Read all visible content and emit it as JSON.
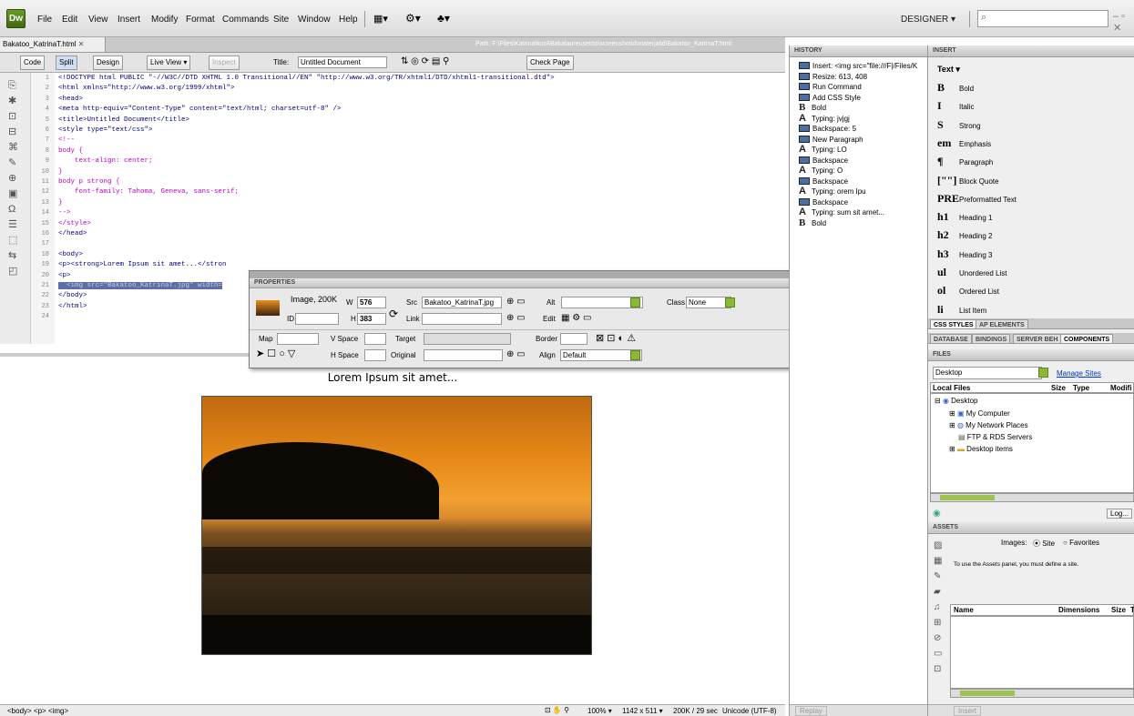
{
  "app": {
    "logo": "Dw",
    "workspace": "DESIGNER"
  },
  "menu": [
    "File",
    "Edit",
    "View",
    "Insert",
    "Modify",
    "Format",
    "Commands",
    "Site",
    "Window",
    "Help"
  ],
  "doc": {
    "tab": "Bakatoo_KatrinaT.html",
    "path": "Path: F:\\Files\\Katrina\\kool\\Bakalaureusetöö\\screenshotid\\materjalid\\Bakatoo_KatrinaT.html"
  },
  "toolbar": {
    "code": "Code",
    "split": "Split",
    "design": "Design",
    "live_view": "Live View",
    "inspect": "Inspect",
    "title_label": "Title:",
    "title_value": "Untitled Document",
    "check_page": "Check Page"
  },
  "code": {
    "line_numbers": [
      "1",
      "2",
      "3",
      "4",
      "5",
      "6",
      "7",
      "8",
      "9",
      "10",
      "11",
      "12",
      "13",
      "14",
      "15",
      "16",
      "17",
      "18",
      "19",
      "20",
      "21",
      "22",
      "23",
      "24"
    ],
    "lines": [
      "<!DOCTYPE html PUBLIC \"-//W3C//DTD XHTML 1.0 Transitional//EN\" \"http://www.w3.org/TR/xhtml1/DTD/xhtml1-transitional.dtd\">",
      "<html xmlns=\"http://www.w3.org/1999/xhtml\">",
      "<head>",
      "<meta http-equiv=\"Content-Type\" content=\"text/html; charset=utf-8\" />",
      "<title>Untitled Document</title>",
      "<style type=\"text/css\">",
      "<!--",
      "body {",
      "    text-align: center;",
      "}",
      "body p strong {",
      "    font-family: Tahoma, Geneva, sans-serif;",
      "}",
      "-->",
      "</style>",
      "</head>",
      "",
      "<body>",
      "<p><strong>Lorem Ipsum sit amet...</stron",
      "<p>",
      "  <img src=\"Bakatoo_KatrinaT.jpg\" width=",
      "</body>",
      "</html>",
      ""
    ]
  },
  "design": {
    "heading": "Lorem Ipsum sit amet..."
  },
  "statusbar": {
    "tags": "<body> <p> <img>",
    "zoom": "100%",
    "size": "1142 x 511",
    "download": "200K / 29 sec",
    "encoding": "Unicode (UTF-8)"
  },
  "properties": {
    "title": "PROPERTIES",
    "type": "Image, 200K",
    "w_label": "W",
    "w_value": "576",
    "h_label": "H",
    "h_value": "383",
    "id_label": "ID",
    "src_label": "Src",
    "src_value": "Bakatoo_KatrinaT.jpg",
    "link_label": "Link",
    "alt_label": "Alt",
    "edit_label": "Edit",
    "class_label": "Class",
    "class_value": "None",
    "map_label": "Map",
    "vspace_label": "V Space",
    "hspace_label": "H Space",
    "target_label": "Target",
    "original_label": "Original",
    "border_label": "Border",
    "align_label": "Align",
    "align_value": "Default"
  },
  "history": {
    "title": "HISTORY",
    "items": [
      {
        "icon": "box",
        "text": "Insert: <img src=\"file:///F|/Files/K"
      },
      {
        "icon": "box",
        "text": "Resize: 613, 408"
      },
      {
        "icon": "box",
        "text": "Run Command"
      },
      {
        "icon": "box",
        "text": "Add CSS Style"
      },
      {
        "icon": "B",
        "text": "Bold"
      },
      {
        "icon": "A",
        "text": "Typing: jvjgj"
      },
      {
        "icon": "box",
        "text": "Backspace: 5"
      },
      {
        "icon": "box",
        "text": "New Paragraph"
      },
      {
        "icon": "A",
        "text": "Typing: LO"
      },
      {
        "icon": "box",
        "text": "Backspace"
      },
      {
        "icon": "A",
        "text": "Typing: O"
      },
      {
        "icon": "box",
        "text": "Backspace"
      },
      {
        "icon": "A",
        "text": "Typing: orem Ipu"
      },
      {
        "icon": "box",
        "text": "Backspace"
      },
      {
        "icon": "A",
        "text": "Typing: sum sit amet..."
      },
      {
        "icon": "B",
        "text": "Bold"
      }
    ],
    "replay": "Replay"
  },
  "insert": {
    "title": "INSERT",
    "category": "Text",
    "items": [
      {
        "glyph": "B",
        "label": "Bold"
      },
      {
        "glyph": "I",
        "label": "Italic"
      },
      {
        "glyph": "S",
        "label": "Strong"
      },
      {
        "glyph": "em",
        "label": "Emphasis"
      },
      {
        "glyph": "¶",
        "label": "Paragraph"
      },
      {
        "glyph": "[\"\"]",
        "label": "Block Quote"
      },
      {
        "glyph": "PRE",
        "label": "Preformatted Text"
      },
      {
        "glyph": "h1",
        "label": "Heading 1"
      },
      {
        "glyph": "h2",
        "label": "Heading 2"
      },
      {
        "glyph": "h3",
        "label": "Heading 3"
      },
      {
        "glyph": "ul",
        "label": "Unordered List"
      },
      {
        "glyph": "ol",
        "label": "Ordered List"
      },
      {
        "glyph": "li",
        "label": "List Item"
      }
    ]
  },
  "panels": {
    "css_styles": "CSS STYLES",
    "ap_elements": "AP ELEMENTS",
    "database": "DATABASE",
    "bindings": "BINDINGS",
    "server_beh": "SERVER BEH",
    "components": "COMPONENTS"
  },
  "files": {
    "title": "FILES",
    "location": "Desktop",
    "manage_sites": "Manage Sites",
    "col_local": "Local Files",
    "col_size": "Size",
    "col_type": "Type",
    "col_modified": "Modifi",
    "tree": [
      "Desktop",
      "My Computer",
      "My Network Places",
      "FTP & RDS Servers",
      "Desktop items"
    ],
    "log": "Log..."
  },
  "assets": {
    "title": "ASSETS",
    "images_label": "Images:",
    "site": "Site",
    "favorites": "Favorites",
    "message": "To use the Assets panel, you must define a site.",
    "col_name": "Name",
    "col_dimensions": "Dimensions",
    "col_size": "Size",
    "col_t": "T",
    "insert": "Insert"
  }
}
